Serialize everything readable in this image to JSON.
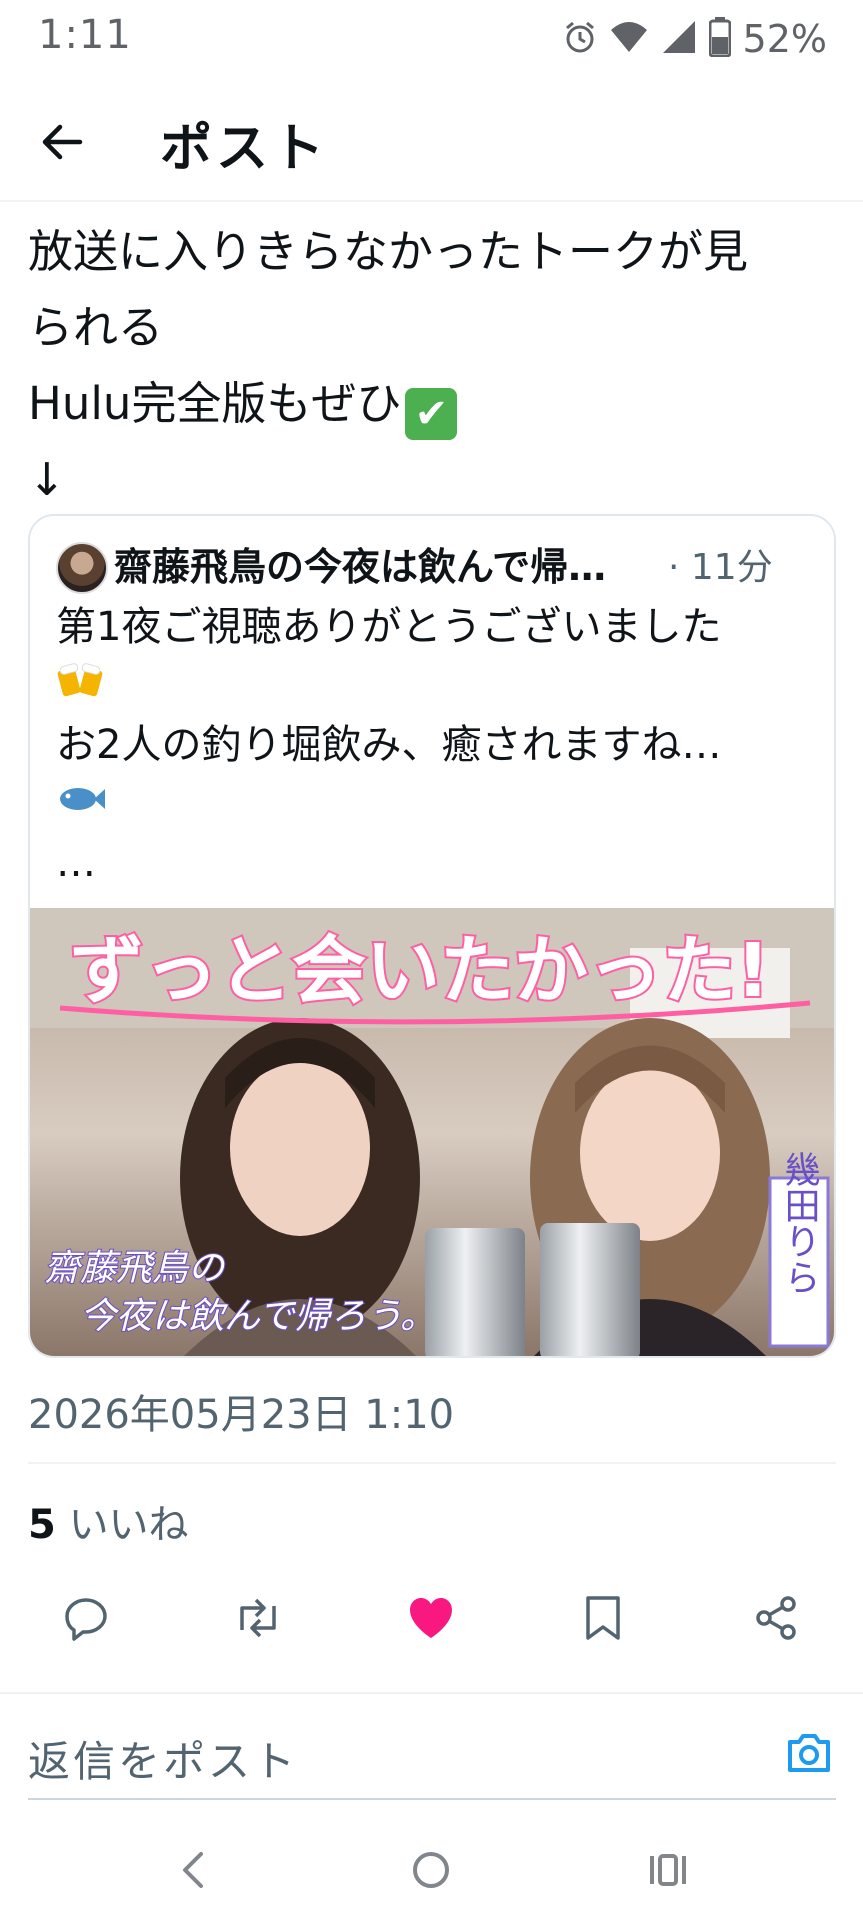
{
  "status_bar": {
    "time": "1:11",
    "battery": "52%",
    "icons": [
      "alarm-icon",
      "wifi-icon",
      "signal-icon",
      "battery-icon"
    ]
  },
  "header": {
    "title": "ポスト",
    "back_icon": "arrow-left-icon"
  },
  "post": {
    "text_lines": [
      "放送に入りきらなかったトークが見",
      "られる",
      "Hulu完全版もぜひ",
      "↓"
    ],
    "check_emoji": "✔",
    "timestamp": "2026年05月23日 1:10",
    "likes_count": "5",
    "likes_label": "いいね"
  },
  "quote": {
    "author": "齋藤飛鳥の今夜は飲んで帰…",
    "meta": "· 11分",
    "body_lines": [
      "第1夜ご視聴ありがとうございました",
      "お2人の釣り堀飲み、癒されますね…",
      "…"
    ],
    "image": {
      "headline": "ずっと会いたかった!",
      "left_caption_line1": "齋藤飛鳥の",
      "left_caption_line2": "今夜は飲んで帰ろう。",
      "right_caption": "幾田りら"
    }
  },
  "actions": {
    "icons": [
      "reply-icon",
      "retweet-icon",
      "like-icon",
      "bookmark-icon",
      "share-icon"
    ],
    "like_color": "#f91880"
  },
  "reply_bar": {
    "placeholder": "返信をポスト",
    "accent": "#1d9bf0"
  },
  "nav_bar": {
    "icons": [
      "back-nav-icon",
      "home-nav-icon",
      "recents-nav-icon"
    ]
  }
}
